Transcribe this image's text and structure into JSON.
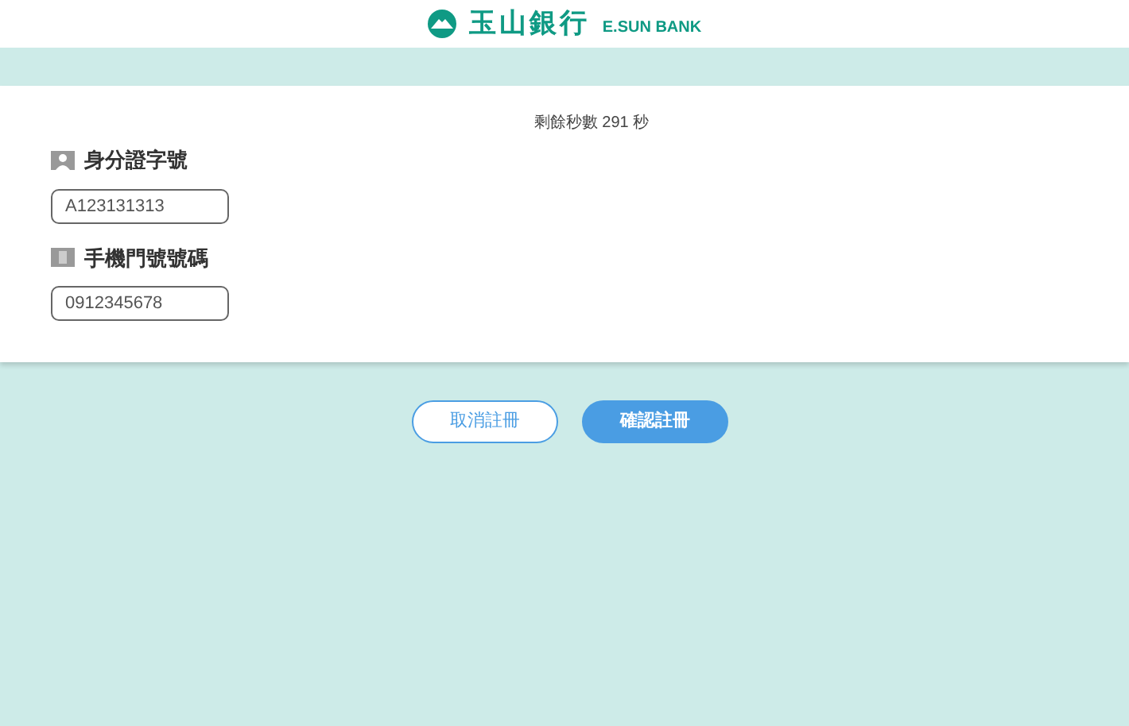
{
  "header": {
    "logo_name": "玉山銀行",
    "logo_english": "E.SUN BANK"
  },
  "countdown": "剩餘秒數 291 秒",
  "fields": [
    {
      "kind": "id",
      "label": "身分證字號",
      "value": "A123131313"
    },
    {
      "kind": "phone",
      "label": "手機門號號碼",
      "value": "0912345678"
    }
  ],
  "buttons": [
    {
      "kind": "outline",
      "label": "取消註冊"
    },
    {
      "kind": "primary",
      "label": "確認註冊"
    }
  ]
}
